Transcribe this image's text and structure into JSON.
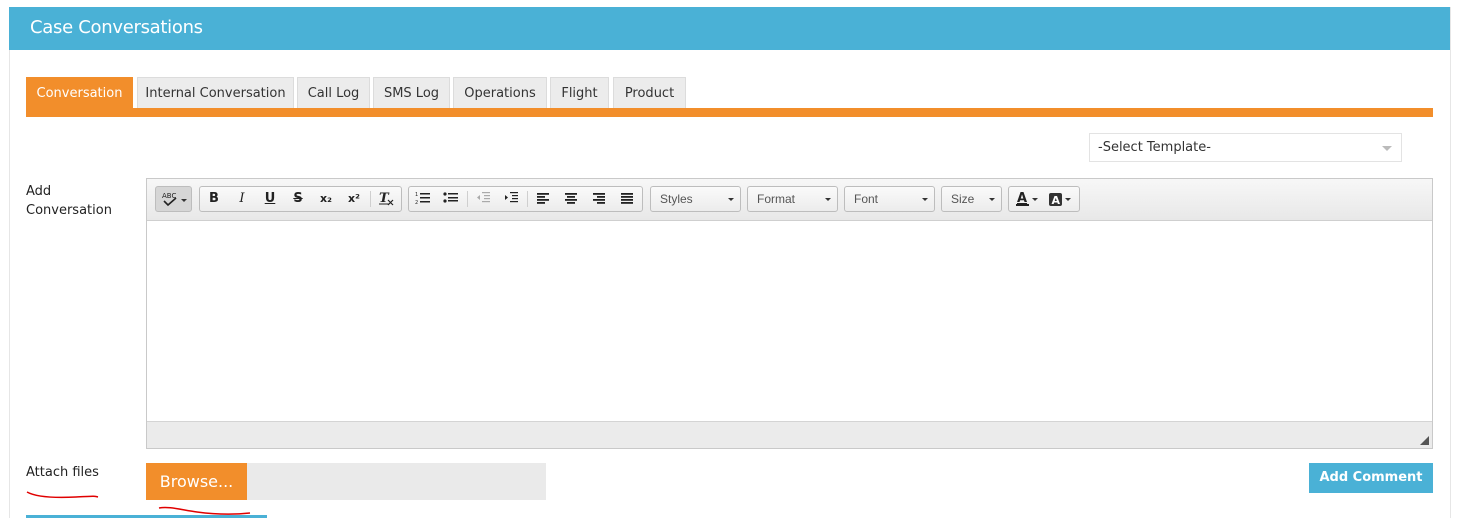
{
  "header": {
    "title": "Case Conversations"
  },
  "tabs": [
    {
      "label": "Conversation",
      "active": true
    },
    {
      "label": "Internal Conversation",
      "active": false
    },
    {
      "label": "Call Log",
      "active": false
    },
    {
      "label": "SMS Log",
      "active": false
    },
    {
      "label": "Operations",
      "active": false
    },
    {
      "label": "Flight",
      "active": false
    },
    {
      "label": "Product",
      "active": false
    }
  ],
  "template_select": {
    "value": "-Select Template-"
  },
  "form": {
    "add_conversation_label_line1": "Add",
    "add_conversation_label_line2": "Conversation",
    "attach_files_label": "Attach files"
  },
  "toolbar": {
    "bold": "B",
    "italic": "I",
    "underline": "U",
    "strike": "S",
    "subscript": "x₂",
    "superscript": "x²",
    "styles": "Styles",
    "format": "Format",
    "font": "Font",
    "size": "Size"
  },
  "file_upload": {
    "browse_label": "Browse..."
  },
  "actions": {
    "add_comment_label": "Add Comment"
  },
  "colors": {
    "header": "#4ab1d6",
    "accent": "#f28e2b",
    "button_blue": "#4ab1d6"
  }
}
